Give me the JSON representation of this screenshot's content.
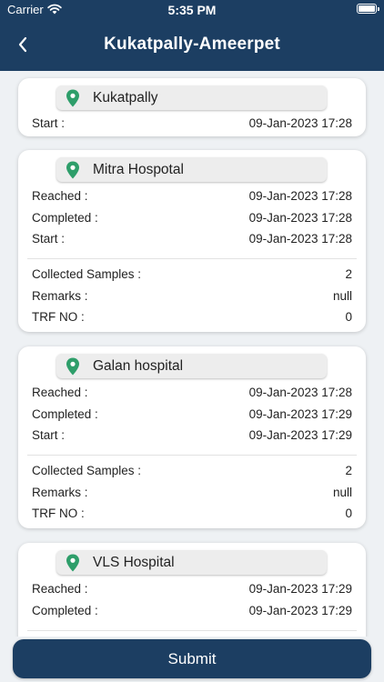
{
  "status_bar": {
    "carrier": "Carrier",
    "time": "5:35 PM"
  },
  "header": {
    "title": "Kukatpally-Ameerpet"
  },
  "colors": {
    "primary": "#1c3e62",
    "pin": "#2e9e6a"
  },
  "icons": {
    "back": "chevron-left-icon",
    "location": "location-pin-icon"
  },
  "stops": [
    {
      "name": "Kukatpally",
      "times": [
        {
          "label": "Start :",
          "value": "09-Jan-2023 17:28"
        }
      ],
      "details": []
    },
    {
      "name": "Mitra Hospotal",
      "times": [
        {
          "label": "Reached :",
          "value": "09-Jan-2023 17:28"
        },
        {
          "label": "Completed :",
          "value": "09-Jan-2023 17:28"
        },
        {
          "label": "Start :",
          "value": "09-Jan-2023 17:28"
        }
      ],
      "details": [
        {
          "label": "Collected Samples :",
          "value": "2"
        },
        {
          "label": "Remarks :",
          "value": "null"
        },
        {
          "label": "TRF NO :",
          "value": "0"
        }
      ]
    },
    {
      "name": "Galan hospital",
      "times": [
        {
          "label": "Reached :",
          "value": "09-Jan-2023 17:28"
        },
        {
          "label": "Completed :",
          "value": "09-Jan-2023 17:29"
        },
        {
          "label": "Start :",
          "value": "09-Jan-2023 17:29"
        }
      ],
      "details": [
        {
          "label": "Collected Samples :",
          "value": "2"
        },
        {
          "label": "Remarks :",
          "value": "null"
        },
        {
          "label": "TRF NO :",
          "value": "0"
        }
      ]
    },
    {
      "name": "VLS Hospital",
      "times": [
        {
          "label": "Reached :",
          "value": "09-Jan-2023 17:29"
        },
        {
          "label": "Completed :",
          "value": "09-Jan-2023 17:29"
        }
      ],
      "details": []
    }
  ],
  "footer": {
    "submit_label": "Submit"
  }
}
